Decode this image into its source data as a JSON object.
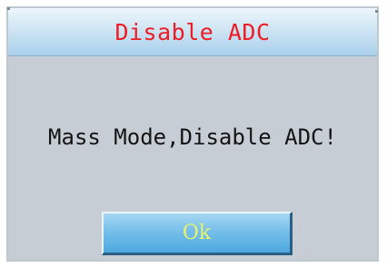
{
  "dialog": {
    "title": "Disable ADC",
    "message": "Mass Mode,Disable ADC!",
    "ok_label": "Ok"
  },
  "colors": {
    "title_text": "#ee1c24",
    "body_background": "#c6cdd5",
    "button_text": "#e8f56a"
  }
}
